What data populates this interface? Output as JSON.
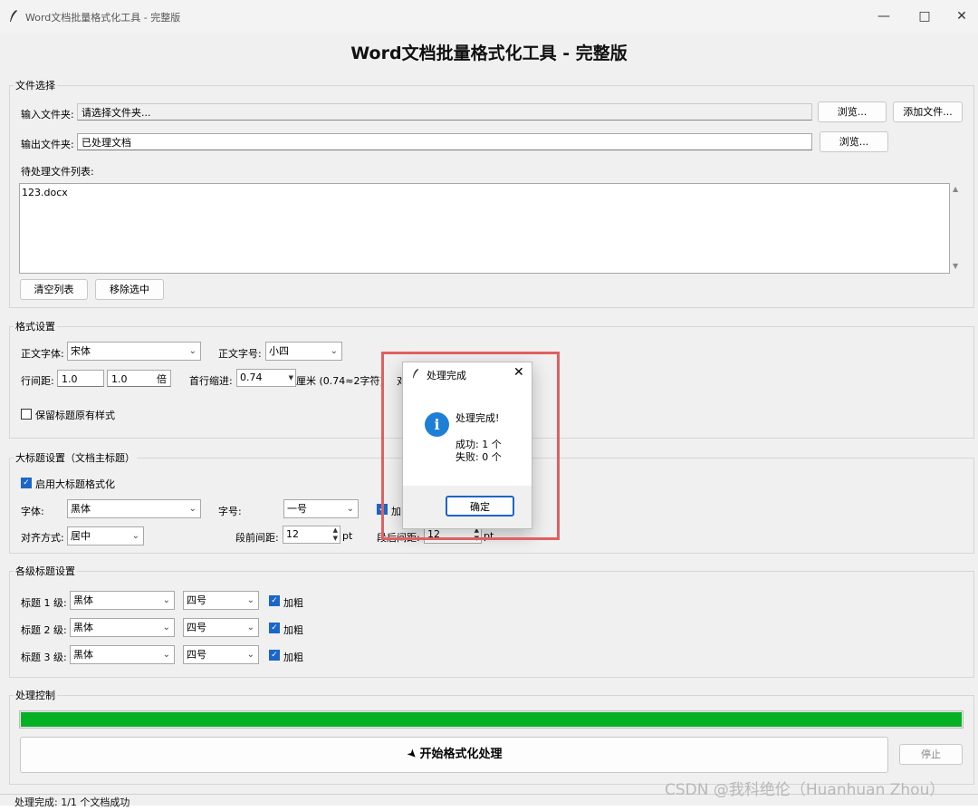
{
  "window": {
    "title": "Word文档批量格式化工具 - 完整版",
    "app_heading": "Word文档批量格式化工具 - 完整版"
  },
  "file_select": {
    "group_label": "文件选择",
    "input_label": "输入文件夹:",
    "input_value": "请选择文件夹...",
    "browse_label": "浏览...",
    "add_files_label": "添加文件...",
    "output_label": "输出文件夹:",
    "output_value": "已处理文档",
    "output_browse_label": "浏览...",
    "pending_label": "待处理文件列表:",
    "files": [
      "123.docx"
    ],
    "clear_label": "清空列表",
    "remove_label": "移除选中"
  },
  "format_settings": {
    "group_label": "格式设置",
    "body_font_label": "正文字体:",
    "body_font_value": "宋体",
    "body_size_label": "正文字号:",
    "body_size_value": "小四",
    "line_spacing_label": "行间距:",
    "line_spacing_value": "1.0",
    "line_spacing_multi": "1.0",
    "line_spacing_unit": "倍",
    "indent_label": "首行缩进:",
    "indent_value": "0.74",
    "indent_unit": "厘米 (0.74≈2字符)",
    "align_label_partial": "对",
    "keep_heading_label": "保留标题原有样式"
  },
  "main_title": {
    "group_label": "大标题设置（文档主标题）",
    "enable_label": "启用大标题格式化",
    "font_label": "字体:",
    "font_value": "黑体",
    "size_label": "字号:",
    "size_value": "一号",
    "bold_partial": "加",
    "align_label": "对齐方式:",
    "align_value": "居中",
    "space_before_label": "段前间距:",
    "space_before_value": "12",
    "space_before_unit": "pt",
    "space_after_label": "段后间距:",
    "space_after_value": "12",
    "space_after_unit": "pt"
  },
  "headings": {
    "group_label": "各级标题设置",
    "rows": [
      {
        "label": "标题 1 级:",
        "font": "黑体",
        "size": "四号",
        "bold": "加粗"
      },
      {
        "label": "标题 2 级:",
        "font": "黑体",
        "size": "四号",
        "bold": "加粗"
      },
      {
        "label": "标题 3 级:",
        "font": "黑体",
        "size": "四号",
        "bold": "加粗"
      }
    ]
  },
  "control": {
    "group_label": "处理控制",
    "progress": 1.0,
    "start_label": "开始格式化处理",
    "stop_label": "停止"
  },
  "status_text": "处理完成: 1/1 个文档成功",
  "dialog": {
    "title": "处理完成",
    "message": "处理完成!",
    "success": "成功: 1 个",
    "failed": "失败: 0 个",
    "ok_label": "确定"
  },
  "watermark": "CSDN @我科绝伦（Huanhuan Zhou）",
  "colors": {
    "progress_fill": "#06b025",
    "checkbox": "#1a66c9",
    "info_icon": "#1f7fd6",
    "highlight_box": "#e06060"
  },
  "icons": [
    "feather-icon",
    "info-icon",
    "close-icon",
    "minimize-icon",
    "maximize-icon",
    "rocket-icon"
  ]
}
